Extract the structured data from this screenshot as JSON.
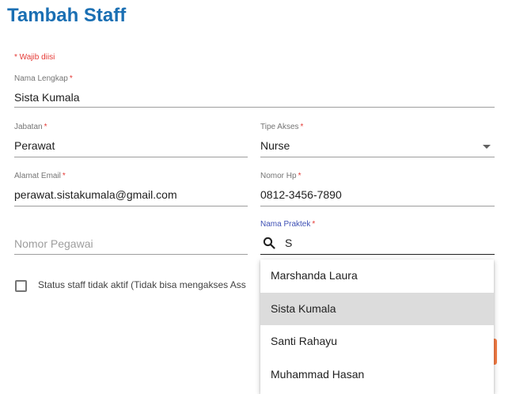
{
  "page": {
    "title": "Tambah Staff"
  },
  "form": {
    "required_note": "* Wajib diisi",
    "nama_lengkap": {
      "label": "Nama Lengkap",
      "required_mark": "*",
      "value": "Sista Kumala"
    },
    "jabatan": {
      "label": "Jabatan",
      "required_mark": "*",
      "value": "Perawat"
    },
    "tipe_akses": {
      "label": "Tipe Akses",
      "required_mark": "*",
      "value": "Nurse"
    },
    "alamat_email": {
      "label": "Alamat Email",
      "required_mark": "*",
      "value": "perawat.sistakumala@gmail.com"
    },
    "nomor_hp": {
      "label": "Nomor Hp",
      "required_mark": "*",
      "value": "0812-3456-7890"
    },
    "nomor_pegawai": {
      "placeholder": "Nomor Pegawai"
    },
    "nama_praktek": {
      "label": "Nama Praktek",
      "required_mark": "*",
      "search_value": "S",
      "search_icon": "search-icon",
      "options": [
        {
          "label": "Marshanda Laura",
          "highlighted": false
        },
        {
          "label": "Sista Kumala",
          "highlighted": true
        },
        {
          "label": "Santi Rahayu",
          "highlighted": false
        },
        {
          "label": "Muhammad Hasan",
          "highlighted": false
        }
      ]
    },
    "status_checkbox": {
      "label": "Status staff tidak aktif (Tidak bisa mengakses Ass",
      "checked": false
    }
  },
  "colors": {
    "title": "#1a6fb3",
    "required": "#e53935",
    "focus": "#3f51b5",
    "highlight": "#dcdcdc",
    "button_accent": "#f57c45"
  }
}
